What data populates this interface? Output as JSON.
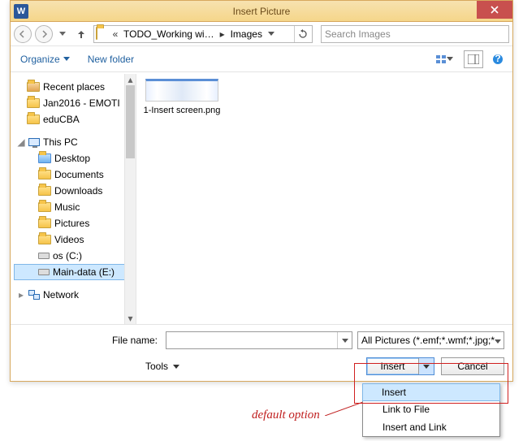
{
  "window": {
    "title": "Insert Picture"
  },
  "nav": {
    "folder_icon": "folder-icon",
    "prefix": "«",
    "seg1": "TODO_Working wi…",
    "seg2": "Images",
    "search_placeholder": "Search Images"
  },
  "toolbar": {
    "organize": "Organize",
    "new_folder": "New folder"
  },
  "tree": {
    "recent": "Recent places",
    "jan2016": "Jan2016 - EMOTI",
    "educba": "eduCBA",
    "thispc": "This PC",
    "desktop": "Desktop",
    "documents": "Documents",
    "downloads": "Downloads",
    "music": "Music",
    "pictures": "Pictures",
    "videos": "Videos",
    "osc": "os (C:)",
    "maindata": "Main-data (E:)",
    "network": "Network"
  },
  "files": {
    "item1": {
      "name": "1-Insert screen.png"
    }
  },
  "footer": {
    "filename_label": "File name:",
    "filename_value": "",
    "filter": "All Pictures (*.emf;*.wmf;*.jpg;*",
    "tools": "Tools",
    "insert": "Insert",
    "cancel": "Cancel"
  },
  "menu": {
    "insert": "Insert",
    "link_to_file": "Link to File",
    "insert_and_link": "Insert and Link"
  },
  "annotation": {
    "default_option": "default option"
  }
}
